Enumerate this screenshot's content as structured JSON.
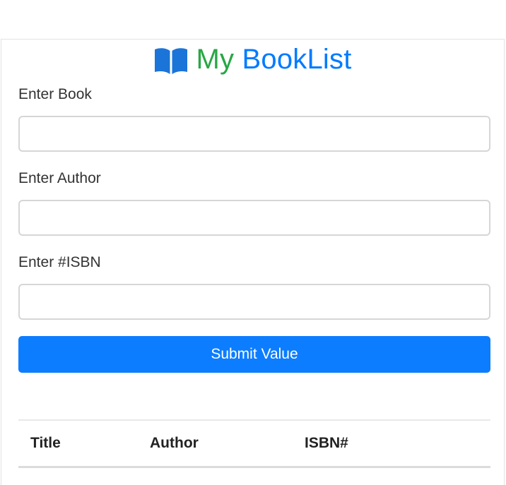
{
  "header": {
    "icon": "book-open-icon",
    "title_part1": "My",
    "title_part2": "BookList",
    "colors": {
      "part1": "#28a745",
      "part2": "#007bff"
    }
  },
  "form": {
    "book_label": "Enter Book",
    "book_value": "",
    "author_label": "Enter Author",
    "author_value": "",
    "isbn_label": "Enter #ISBN",
    "isbn_value": "",
    "submit_label": "Submit Value",
    "submit_color": "#0d7dff"
  },
  "table": {
    "columns": [
      "Title",
      "Author",
      "ISBN#"
    ],
    "rows": []
  }
}
